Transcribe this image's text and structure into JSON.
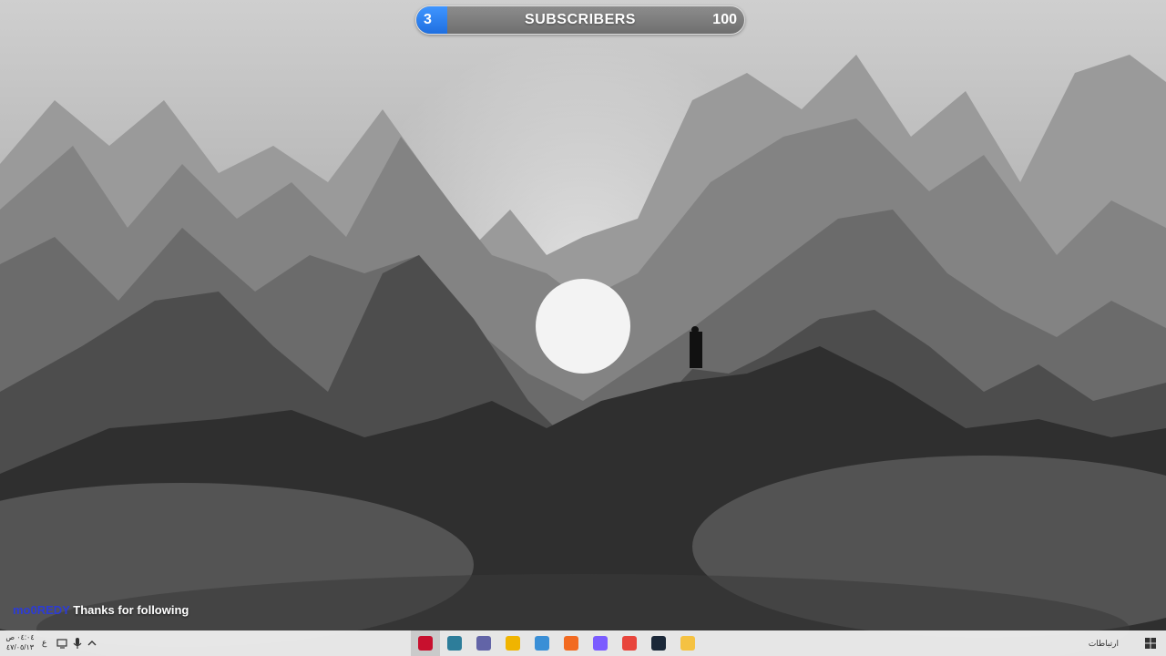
{
  "subscriber_goal": {
    "current": "3",
    "label": "SUBSCRIBERS",
    "goal": "100",
    "progress_fraction": 0.03
  },
  "follow_alert": {
    "follower_name": "mo0REDY",
    "message": "Thanks for following"
  },
  "taskbar": {
    "clock_time": "٠٤:٠٤ ص",
    "clock_date": "٤٧/٠٥/١٣",
    "language": "ع",
    "links_label": "ارتباطات",
    "tray_icons": [
      "network-icon",
      "microphone-icon",
      "chevron-up-icon"
    ],
    "apps": [
      {
        "name": "obs-app",
        "color": "#c8102e",
        "active": true
      },
      {
        "name": "notes-app",
        "color": "#2d7d9a"
      },
      {
        "name": "teams-app",
        "color": "#6264a7"
      },
      {
        "name": "discord-app",
        "color": "#f0b400"
      },
      {
        "name": "terminal-app",
        "color": "#3a8fd6"
      },
      {
        "name": "fonts-app",
        "color": "#f26a21"
      },
      {
        "name": "messenger-app",
        "color": "#7b5cff"
      },
      {
        "name": "chrome-app",
        "color": "#e8453c"
      },
      {
        "name": "steam-app",
        "color": "#1b2838"
      },
      {
        "name": "file-explorer-app",
        "color": "#f5c242"
      }
    ]
  },
  "colors": {
    "progress_fill": "#2f84f5",
    "follower_name": "#2c3bd6"
  }
}
